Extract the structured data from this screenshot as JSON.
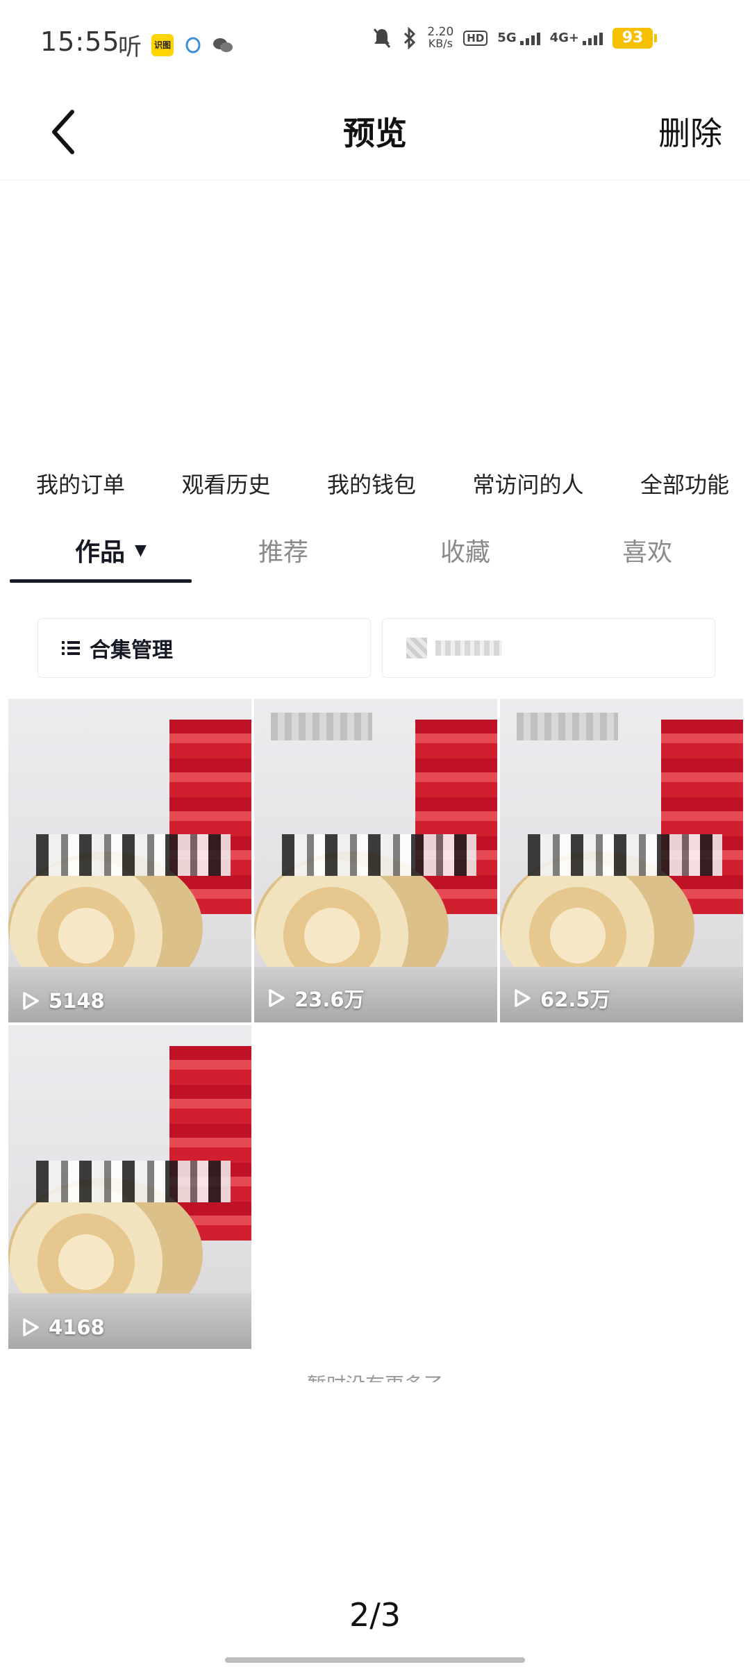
{
  "status_bar": {
    "time": "15:55",
    "app_ting": "听",
    "app_box": "识图",
    "net_speed_value": "2.20",
    "net_speed_unit": "KB/s",
    "hd": "HD",
    "sim1": "5G",
    "sim2": "4G+",
    "battery": "93"
  },
  "nav": {
    "title": "预览",
    "delete_label": "删除"
  },
  "quick_links": [
    "我的订单",
    "观看历史",
    "我的钱包",
    "常访问的人",
    "全部功能"
  ],
  "tabs": [
    {
      "label": "作品",
      "caret": "▼"
    },
    {
      "label": "推荐"
    },
    {
      "label": "收藏"
    },
    {
      "label": "喜欢"
    }
  ],
  "filters": {
    "collection_label": "合集管理"
  },
  "videos": [
    {
      "views": "5148"
    },
    {
      "views": "23.6万"
    },
    {
      "views": "62.5万"
    },
    {
      "views": "4168"
    }
  ],
  "end_text": "暂时没有更多了",
  "page_indicator": "2/3",
  "colors": {
    "text_primary": "#161823",
    "text_muted": "#8a8a8a",
    "battery": "#f5c000",
    "accent_red": "#d01f2e"
  }
}
